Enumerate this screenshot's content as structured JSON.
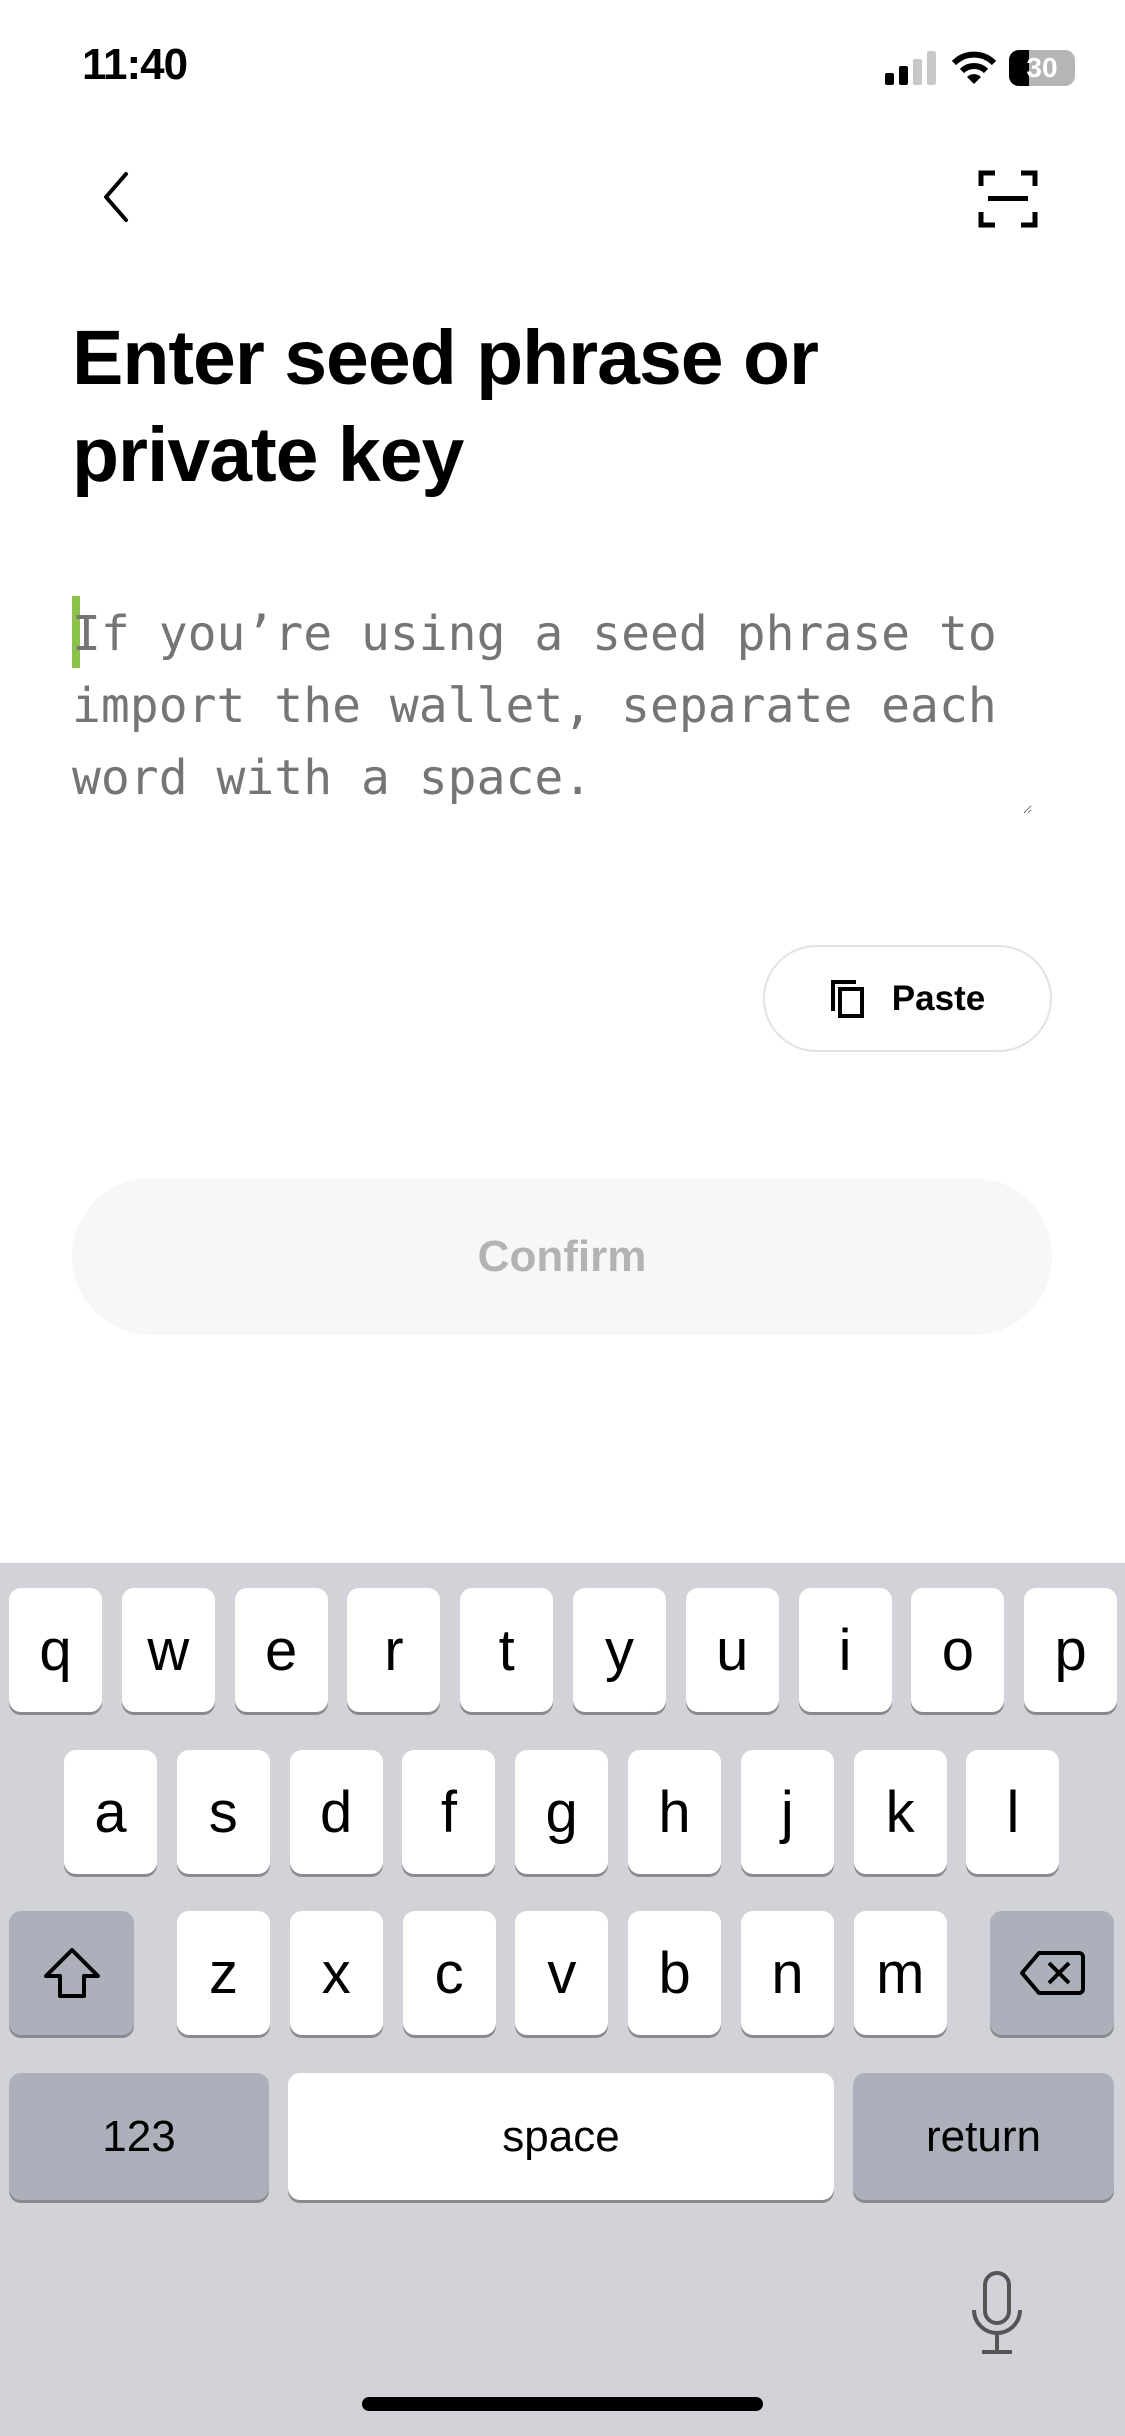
{
  "status_bar": {
    "time": "11:40",
    "battery": "30"
  },
  "nav": {
    "back_icon": "chevron-left-icon",
    "scan_icon": "scan-icon"
  },
  "title": "Enter seed phrase or private key",
  "input": {
    "value": "",
    "placeholder": "If you’re using a seed phrase to import the wallet, separate each word with a space."
  },
  "paste_label": "Paste",
  "confirm_label": "Confirm",
  "keyboard": {
    "row1": [
      "q",
      "w",
      "e",
      "r",
      "t",
      "y",
      "u",
      "i",
      "o",
      "p"
    ],
    "row2": [
      "a",
      "s",
      "d",
      "f",
      "g",
      "h",
      "j",
      "k",
      "l"
    ],
    "row3": [
      "z",
      "x",
      "c",
      "v",
      "b",
      "n",
      "m"
    ],
    "numbers": "123",
    "space": "space",
    "return": "return"
  },
  "colors": {
    "caret": "#8bc34a",
    "keyboard_bg": "#d1d3d9"
  }
}
